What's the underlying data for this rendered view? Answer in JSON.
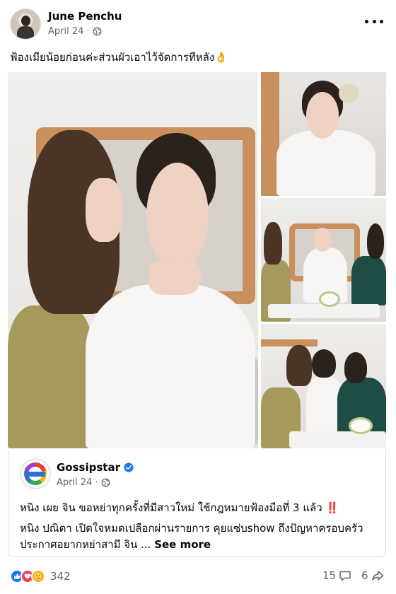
{
  "post": {
    "author": "June Penchu",
    "date": "April 24",
    "privacy_icon": "globe-icon",
    "caption": "ฟ้องเมียน้อยก่อนค่ะส่วนผัวเอาไว้จัดการทีหลัง👌"
  },
  "shared_card": {
    "page_name": "Gossipstar",
    "verified_icon": "verified-badge-icon",
    "date": "April 24",
    "headline": "หนิง เผย จิน ขอหย่าทุกครั้งที่มีสาวใหม่ ใช้กฎหมายฟ้องมือที่ 3 แล้ว",
    "headline_emoji": "‼️",
    "body": "หนิง ปณิตา เปิดใจหมดเปลือกผ่านรายการ คุยแซ่บshow ถึงปัญหาครอบครัว ประกาศอยากหย่าสามี จิน ...",
    "see_more": "See more"
  },
  "footer": {
    "reaction_icons": [
      "like-icon",
      "love-icon",
      "care-icon"
    ],
    "reaction_count": "342",
    "comment_count": "15",
    "share_count": "6"
  },
  "colors": {
    "accent": "#1877f2",
    "secondary_text": "#65676b",
    "frame": "#c98f5c"
  }
}
